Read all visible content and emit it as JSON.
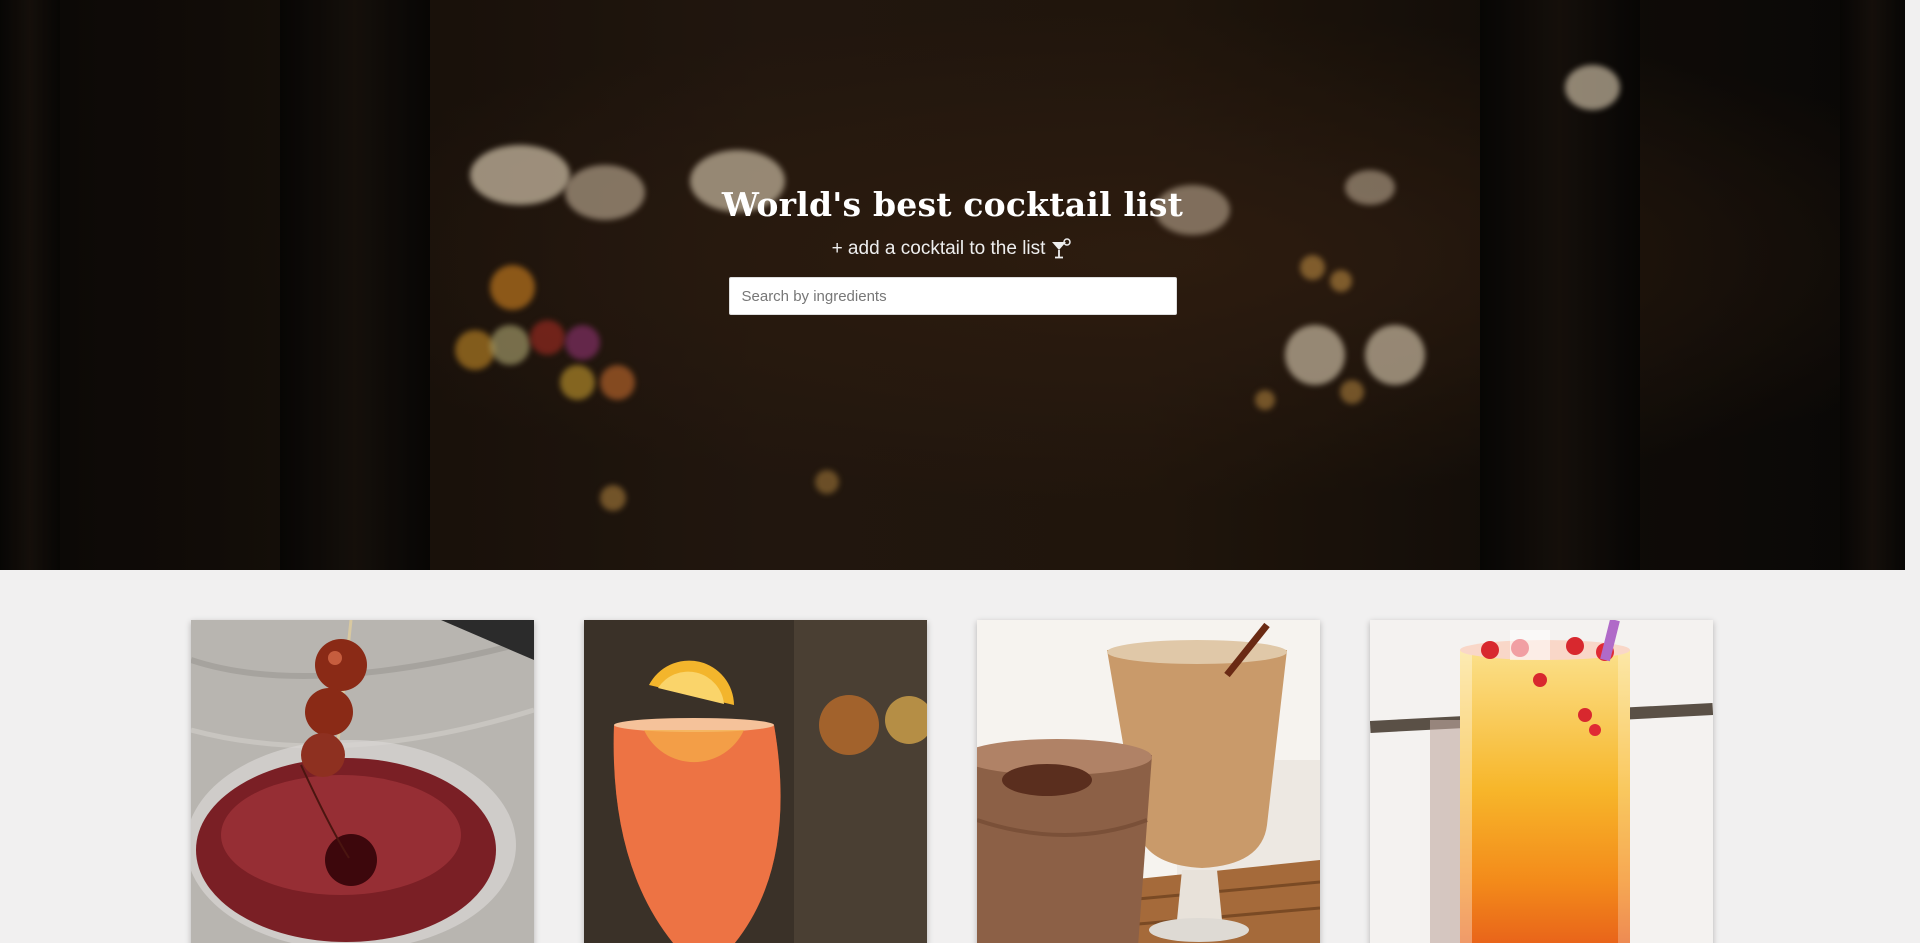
{
  "hero": {
    "title": "World's best cocktail list",
    "add_link_label": "+ add a cocktail to the list",
    "add_link_icon": "martini-glass-icon",
    "search": {
      "placeholder": "Search by ingredients",
      "value": ""
    }
  },
  "cards": [
    {
      "name": "cocktail-card-1",
      "image": "red cocktail in coupe glass with cherries"
    },
    {
      "name": "cocktail-card-2",
      "image": "orange spritz with orange slice"
    },
    {
      "name": "cocktail-card-3",
      "image": "two creamy coffee shakes"
    },
    {
      "name": "cocktail-card-4",
      "image": "tequila sunrise in tall glass"
    }
  ],
  "colors": {
    "page_background": "#f1f0f0",
    "hero_text": "#ffffff",
    "card_shadow": "#999999"
  }
}
